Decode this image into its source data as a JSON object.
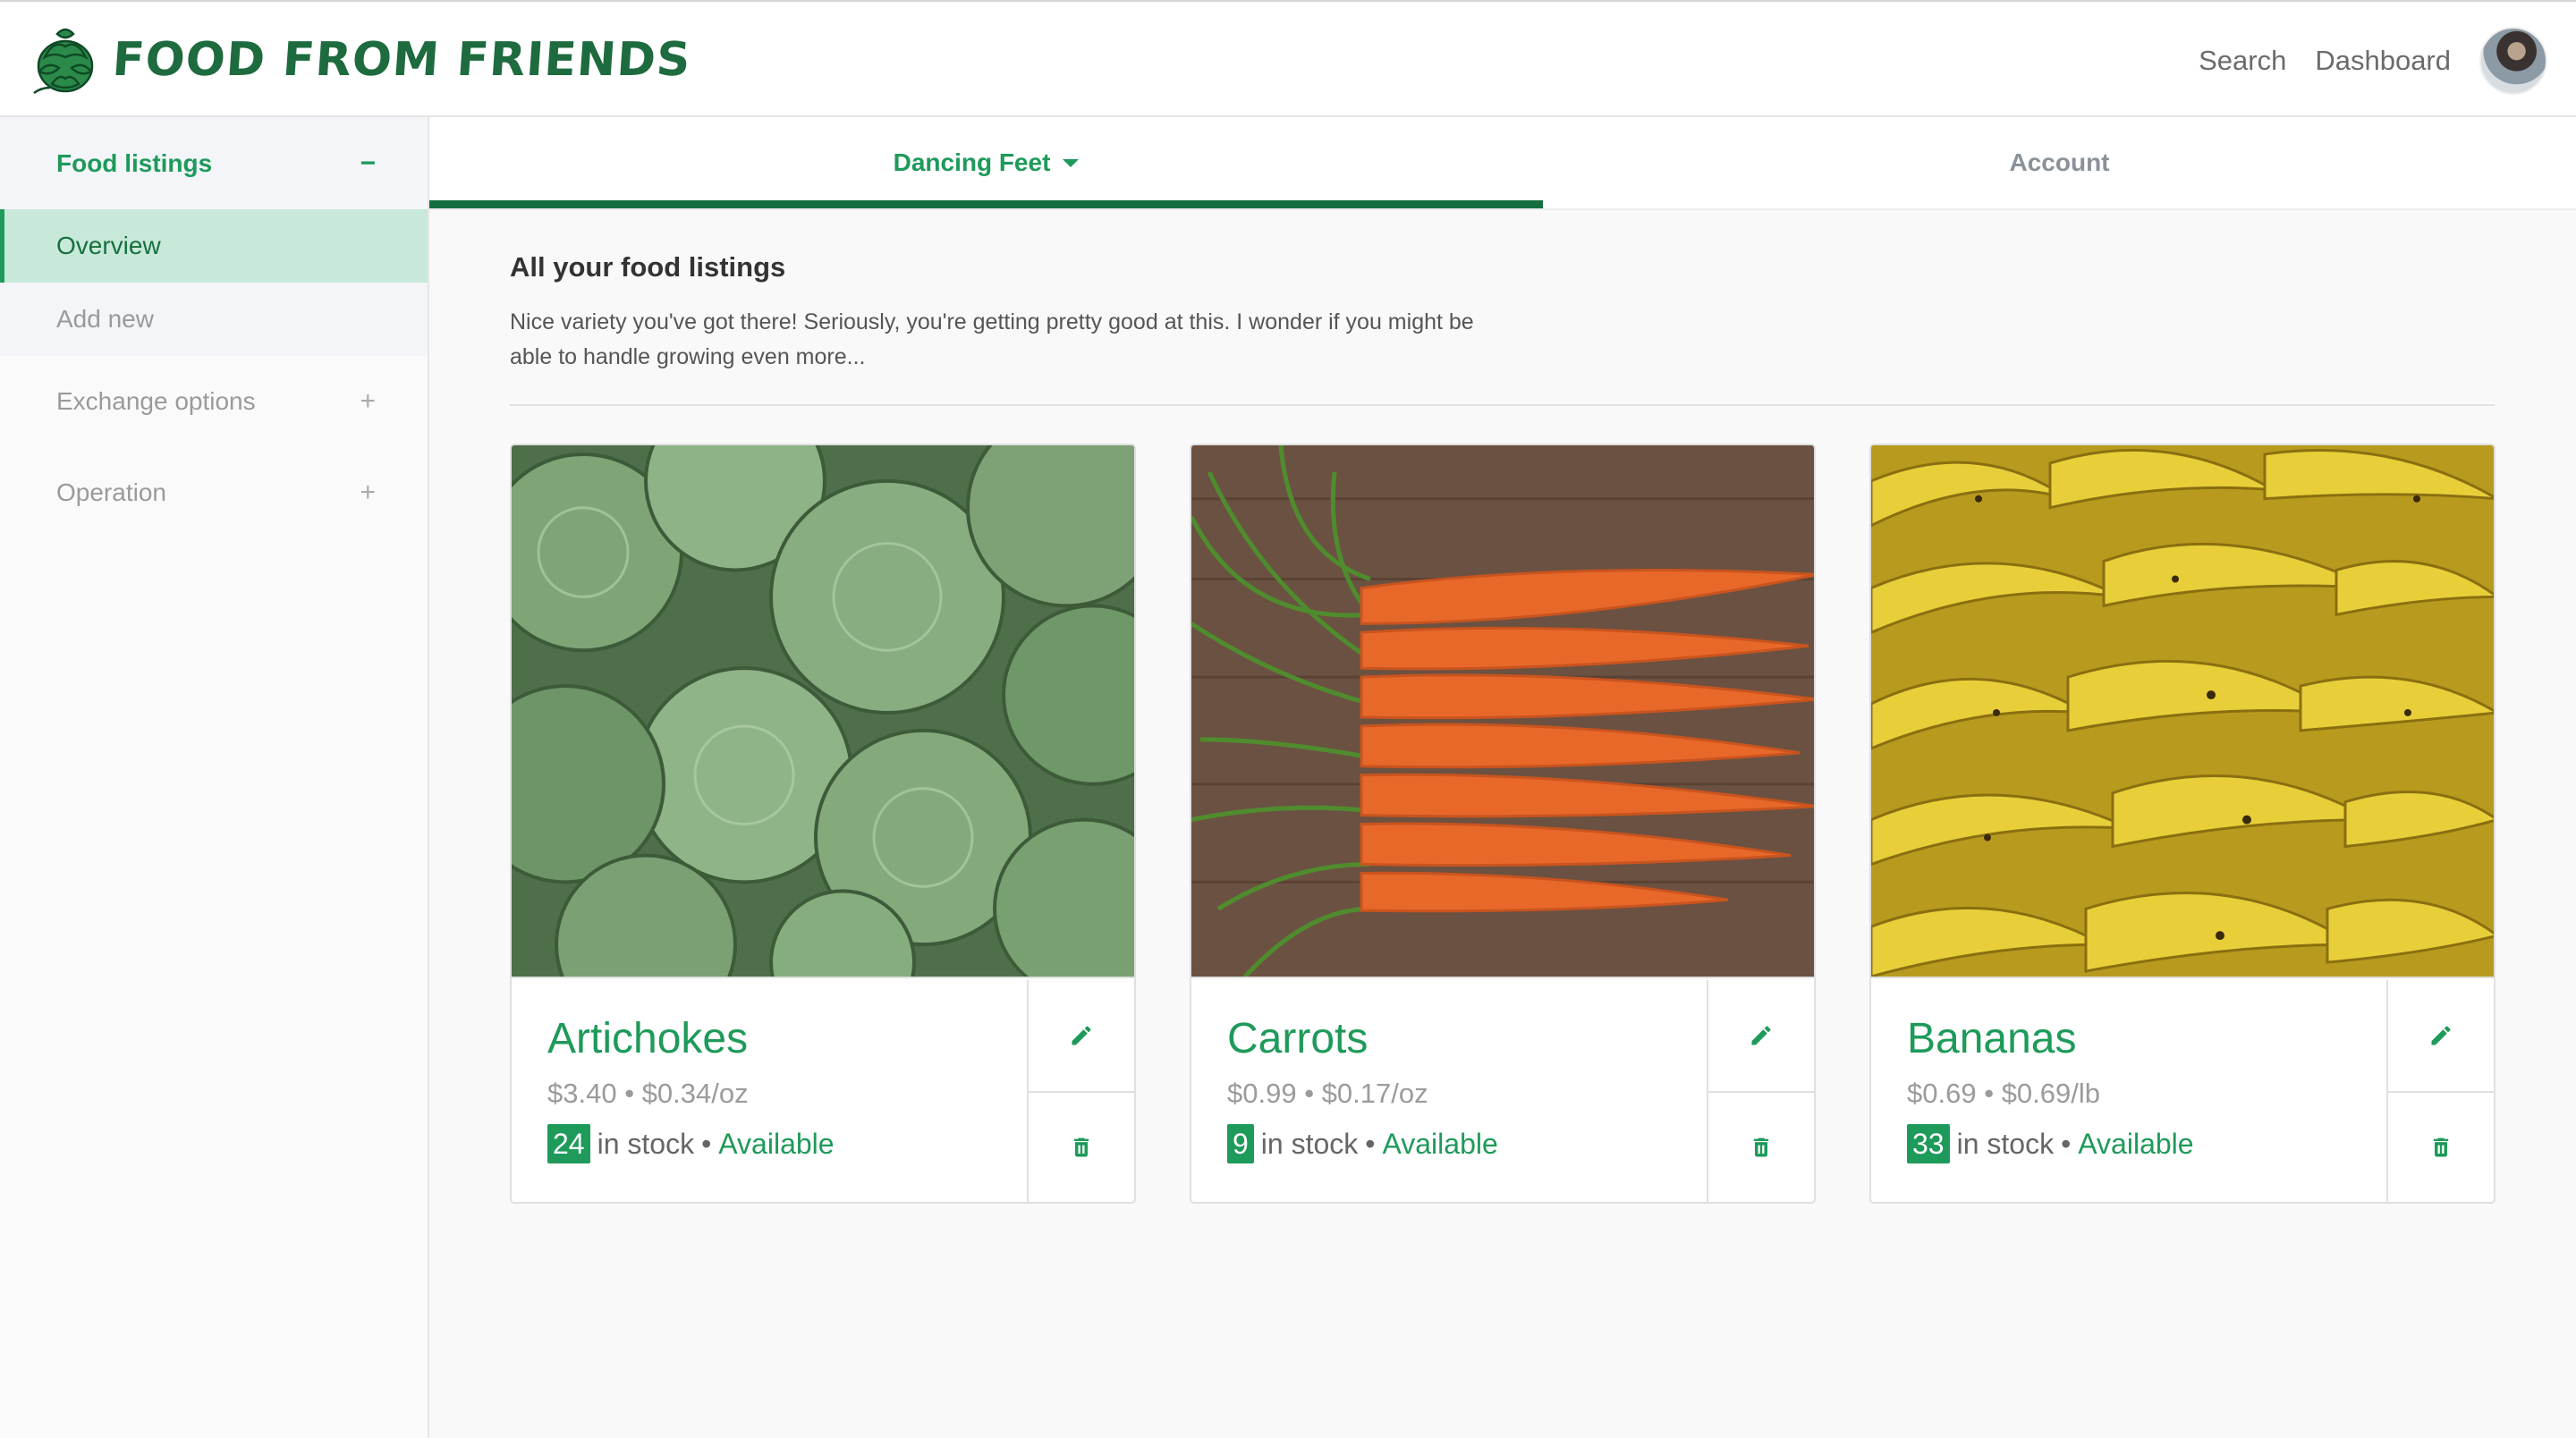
{
  "brand": {
    "name": "FOOD FROM FRIENDS"
  },
  "topnav": {
    "search": "Search",
    "dashboard": "Dashboard"
  },
  "sidebar": {
    "sections": [
      {
        "label": "Food listings",
        "toggle": "−",
        "expanded": true,
        "items": [
          {
            "label": "Overview",
            "selected": true
          },
          {
            "label": "Add new",
            "selected": false
          }
        ]
      },
      {
        "label": "Exchange options",
        "toggle": "+",
        "expanded": false
      },
      {
        "label": "Operation",
        "toggle": "+",
        "expanded": false
      }
    ]
  },
  "tabs": [
    {
      "label": "Dancing Feet",
      "active": true
    },
    {
      "label": "Account",
      "active": false
    }
  ],
  "main": {
    "heading": "All your food listings",
    "intro": "Nice variety you've got there! Seriously, you're getting pretty good at this. I wonder if you might be able to handle growing even more..."
  },
  "listings": [
    {
      "name": "Artichokes",
      "price": "$3.40",
      "unit_price": "$0.34/oz",
      "stock": "24",
      "stock_label": "in stock",
      "separator": "•",
      "status": "Available"
    },
    {
      "name": "Carrots",
      "price": "$0.99",
      "unit_price": "$0.17/oz",
      "stock": "9",
      "stock_label": "in stock",
      "separator": "•",
      "status": "Available"
    },
    {
      "name": "Bananas",
      "price": "$0.69",
      "unit_price": "$0.69/lb",
      "stock": "33",
      "stock_label": "in stock",
      "separator": "•",
      "status": "Available"
    }
  ],
  "icons": {
    "edit": "pencil-icon",
    "delete": "trash-icon",
    "logo": "artichoke-logo-icon",
    "dropdown": "caret-down-icon"
  },
  "colors": {
    "accent": "#1e9a5a",
    "brand": "#1d6b3e",
    "selected_bg": "#c8e9da"
  }
}
